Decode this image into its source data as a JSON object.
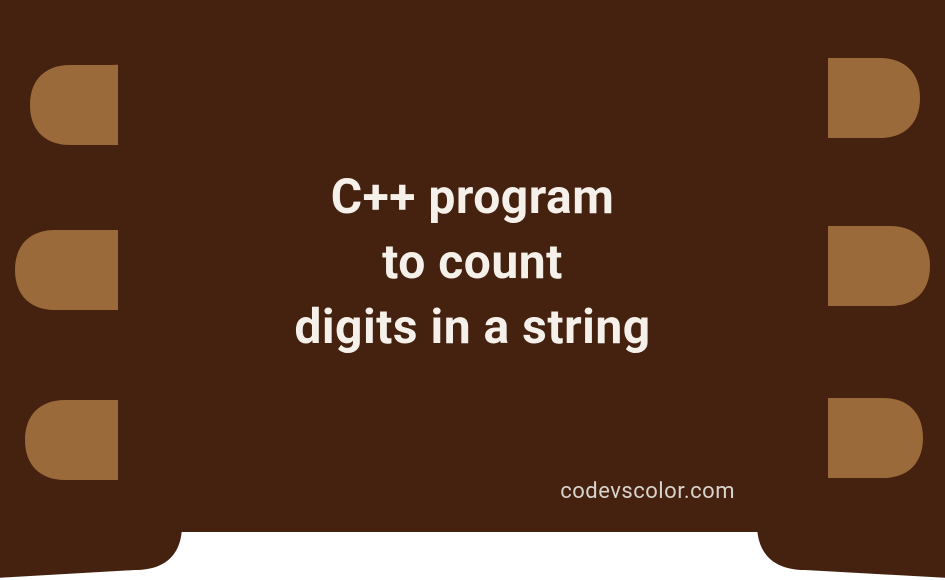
{
  "title": {
    "line1": "C++ program",
    "line2": "to count",
    "line3": "digits in a string"
  },
  "watermark": "codevscolor.com",
  "colors": {
    "background_outer": "#9b6a3a",
    "background_inner": "#45210f",
    "text_primary": "#f5f1ea",
    "text_secondary": "#d8d4cc"
  }
}
